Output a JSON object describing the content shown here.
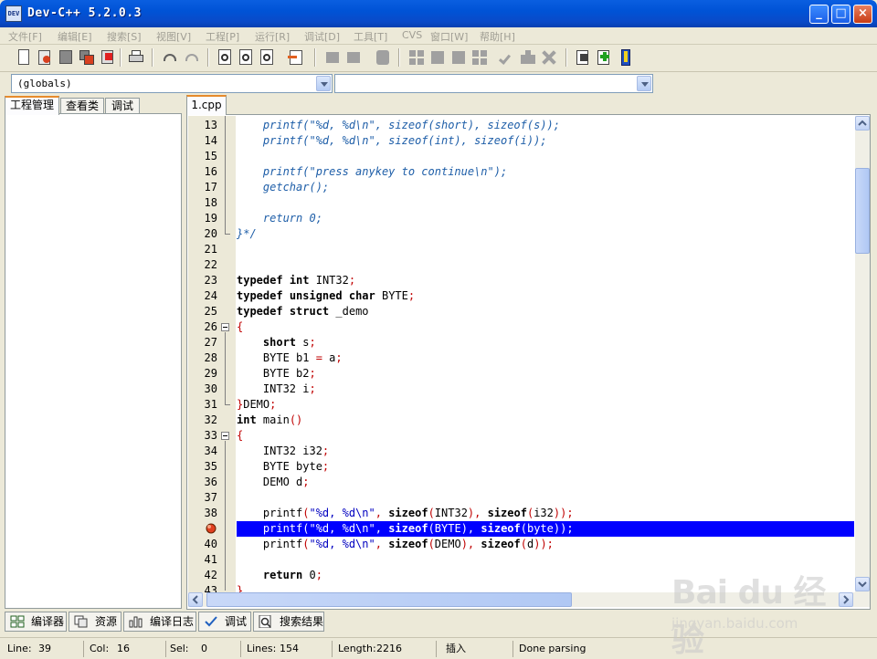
{
  "window": {
    "title": "Dev-C++ 5.2.0.3",
    "icon_label": "DEV",
    "minimize": "_",
    "maximize": "□",
    "close": "×"
  },
  "menu": [
    "文件[F]",
    "编辑[E]",
    "搜索[S]",
    "视图[V]",
    "工程[P]",
    "运行[R]",
    "调试[D]",
    "工具[T]",
    "CVS",
    "窗口[W]",
    "帮助[H]"
  ],
  "combos": {
    "scope": "(globals)",
    "function": ""
  },
  "left_tabs": [
    "工程管理",
    "查看类",
    "调试"
  ],
  "editor": {
    "tab": "1.cpp",
    "lines": [
      {
        "n": "13",
        "html": "<span class=\"comment\">    printf(\"%d, %d\\n\", sizeof(short), sizeof(s));</span>"
      },
      {
        "n": "14",
        "html": "<span class=\"comment\">    printf(\"%d, %d\\n\", sizeof(int), sizeof(i));</span>"
      },
      {
        "n": "15",
        "html": ""
      },
      {
        "n": "16",
        "html": "<span class=\"comment\">    printf(\"press anykey to continue\\n\");</span>"
      },
      {
        "n": "17",
        "html": "<span class=\"comment\">    getchar();</span>"
      },
      {
        "n": "18",
        "html": ""
      },
      {
        "n": "19",
        "html": "<span class=\"comment\">    return 0;</span>"
      },
      {
        "n": "20",
        "html": "<span class=\"comment\">}*/</span>"
      },
      {
        "n": "21",
        "html": ""
      },
      {
        "n": "22",
        "html": ""
      },
      {
        "n": "23",
        "html": "<span class=\"kw\">typedef</span> <span class=\"kw\">int</span> INT32<span class=\"sym\">;</span>"
      },
      {
        "n": "24",
        "html": "<span class=\"kw\">typedef</span> <span class=\"kw\">unsigned</span> <span class=\"kw\">char</span> BYTE<span class=\"sym\">;</span>"
      },
      {
        "n": "25",
        "html": "<span class=\"kw\">typedef</span> <span class=\"kw\">struct</span> _demo"
      },
      {
        "n": "26",
        "html": "<span class=\"sym\">{</span>"
      },
      {
        "n": "27",
        "html": "    <span class=\"kw\">short</span> s<span class=\"sym\">;</span>"
      },
      {
        "n": "28",
        "html": "    BYTE b1 <span class=\"sym\">=</span> a<span class=\"sym\">;</span>"
      },
      {
        "n": "29",
        "html": "    BYTE b2<span class=\"sym\">;</span>"
      },
      {
        "n": "30",
        "html": "    INT32 i<span class=\"sym\">;</span>"
      },
      {
        "n": "31",
        "html": "<span class=\"sym\">}</span>DEMO<span class=\"sym\">;</span>"
      },
      {
        "n": "32",
        "html": "<span class=\"kw\">int</span> main<span class=\"sym\">()</span>"
      },
      {
        "n": "33",
        "html": "<span class=\"sym\">{</span>"
      },
      {
        "n": "34",
        "html": "    INT32 i32<span class=\"sym\">;</span>"
      },
      {
        "n": "35",
        "html": "    BYTE byte<span class=\"sym\">;</span>"
      },
      {
        "n": "36",
        "html": "    DEMO d<span class=\"sym\">;</span>"
      },
      {
        "n": "37",
        "html": ""
      },
      {
        "n": "38",
        "html": "    printf<span class=\"sym\">(</span><span class=\"str\">\"%d, %d\\n\"</span><span class=\"sym\">,</span> <span class=\"kw\">sizeof</span><span class=\"sym\">(</span>INT32<span class=\"sym\">),</span> <span class=\"kw\">sizeof</span><span class=\"sym\">(</span>i32<span class=\"sym\">));</span>"
      },
      {
        "n": "39",
        "html": "    printf<span class=\"sym\">(</span><span class=\"str\">\"%d, %d\\n\"</span><span class=\"sym\">,</span> <span class=\"kw\">sizeof</span><span class=\"sym\">(</span>BYTE<span class=\"sym\">),</span> <span class=\"kw\">sizeof</span><span class=\"sym\">(</span>byte<span class=\"sym\">));</span>",
        "highlight": true
      },
      {
        "n": "40",
        "html": "    printf<span class=\"sym\">(</span><span class=\"str\">\"%d, %d\\n\"</span><span class=\"sym\">,</span> <span class=\"kw\">sizeof</span><span class=\"sym\">(</span>DEMO<span class=\"sym\">),</span> <span class=\"kw\">sizeof</span><span class=\"sym\">(</span>d<span class=\"sym\">));</span>"
      },
      {
        "n": "41",
        "html": ""
      },
      {
        "n": "42",
        "html": "    <span class=\"kw\">return</span> 0<span class=\"sym\">;</span>"
      },
      {
        "n": "43",
        "html": "<span class=\"sym\">}</span>"
      }
    ]
  },
  "bottom_tabs": [
    "编译器",
    "资源",
    "编译日志",
    "调试",
    "搜索结果"
  ],
  "status": {
    "line_label": "Line:",
    "line_value": "39",
    "col_label": "Col:",
    "col_value": "16",
    "sel_label": "Sel:",
    "sel_value": "0",
    "lines_label": "Lines:",
    "lines_value": "154",
    "length_label": "Length:",
    "length_value": "2216",
    "mode": "插入",
    "message": "Done parsing"
  },
  "watermark": {
    "logo": "Bai du 经验",
    "url": "jingyan.baidu.com"
  },
  "colors": {
    "titlebar": "#0053d6",
    "highlight_line": "#0000ff",
    "comment": "#1e5ea8",
    "symbol": "#c00000",
    "string": "#0000c0"
  }
}
